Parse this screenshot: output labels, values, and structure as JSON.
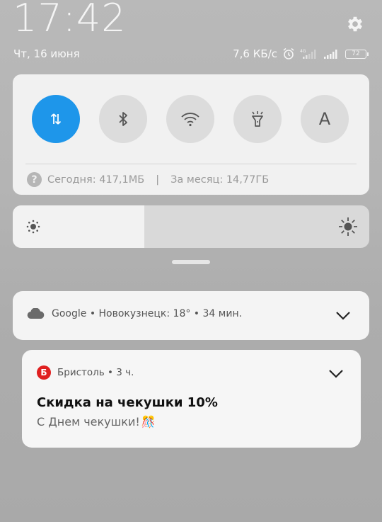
{
  "status_bar": {
    "time": "17:42",
    "date": "Чт, 16 июня",
    "net_speed": "7,6 КБ/с",
    "network_type": "4G",
    "battery": "72"
  },
  "quick_toggles": [
    {
      "name": "mobile-data",
      "icon": "data-transfer-icon",
      "active": true
    },
    {
      "name": "bluetooth",
      "icon": "bluetooth-icon",
      "active": false
    },
    {
      "name": "wifi",
      "icon": "wifi-icon",
      "active": false
    },
    {
      "name": "flashlight",
      "icon": "flashlight-icon",
      "active": false
    },
    {
      "name": "auto-brightness",
      "icon": "letter-a-icon",
      "label": "A",
      "active": false
    }
  ],
  "data_usage": {
    "help_icon": "?",
    "today": "Сегодня: 417,1МБ",
    "separator": "|",
    "month": "За месяц: 14,77ГБ"
  },
  "brightness": {
    "level": 0.37
  },
  "notifications": [
    {
      "app": "Google",
      "summary": "Google • Новокузнецк: 18° • 34 мин.",
      "icon": "cloud-icon"
    },
    {
      "app_badge": "Б",
      "header": "Бристоль • 3 ч.",
      "title": "Скидка на чекушки 10%",
      "body": "С Днем чекушки!",
      "emoji": "🎊"
    }
  ],
  "colors": {
    "accent": "#1e96ea",
    "brand_red": "#e02020"
  }
}
